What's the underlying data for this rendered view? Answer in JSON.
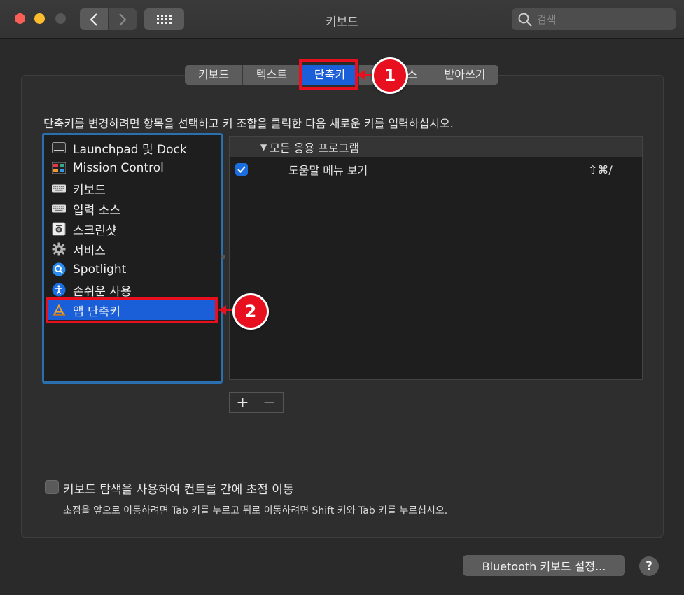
{
  "window": {
    "title": "키보드"
  },
  "search": {
    "placeholder": "검색"
  },
  "tabs": [
    {
      "label": "키보드",
      "active": false
    },
    {
      "label": "텍스트",
      "active": false
    },
    {
      "label": "단축키",
      "active": true
    },
    {
      "label": "입력 소스",
      "active": false
    },
    {
      "label": "받아쓰기",
      "active": false
    }
  ],
  "instruction": "단축키를 변경하려면 항목을 선택하고 키 조합을 클릭한 다음 새로운 키를 입력하십시오.",
  "categories": [
    {
      "label": "Launchpad 및 Dock",
      "icon": "launchpad-dock-icon"
    },
    {
      "label": "Mission Control",
      "icon": "mission-control-icon"
    },
    {
      "label": "키보드",
      "icon": "keyboard-icon"
    },
    {
      "label": "입력 소스",
      "icon": "input-source-icon"
    },
    {
      "label": "스크린샷",
      "icon": "screenshot-icon"
    },
    {
      "label": "서비스",
      "icon": "gear-icon"
    },
    {
      "label": "Spotlight",
      "icon": "spotlight-icon"
    },
    {
      "label": "손쉬운 사용",
      "icon": "accessibility-icon"
    },
    {
      "label": "앱 단축키",
      "icon": "app-store-icon",
      "selected": true
    }
  ],
  "shortcuts": {
    "group_label": "모든 응용 프로그램",
    "rows": [
      {
        "checked": true,
        "label": "도움말 메뉴 보기",
        "keys": "⇧⌘/"
      }
    ]
  },
  "plus_label": "+",
  "minus_label": "−",
  "keyboard_nav": {
    "label": "키보드 탐색을 사용하여 컨트롤 간에 초점 이동",
    "description": "초점을 앞으로 이동하려면 Tab 키를 누르고 뒤로 이동하려면 Shift 키와 Tab 키를 누르십시오.",
    "checked": false
  },
  "bluetooth_button": "Bluetooth 키보드 설정...",
  "help_label": "?",
  "annotations": {
    "badge1": "1",
    "badge2": "2"
  },
  "colors": {
    "accent": "#1a5fd7",
    "highlight": "#e8101f"
  }
}
